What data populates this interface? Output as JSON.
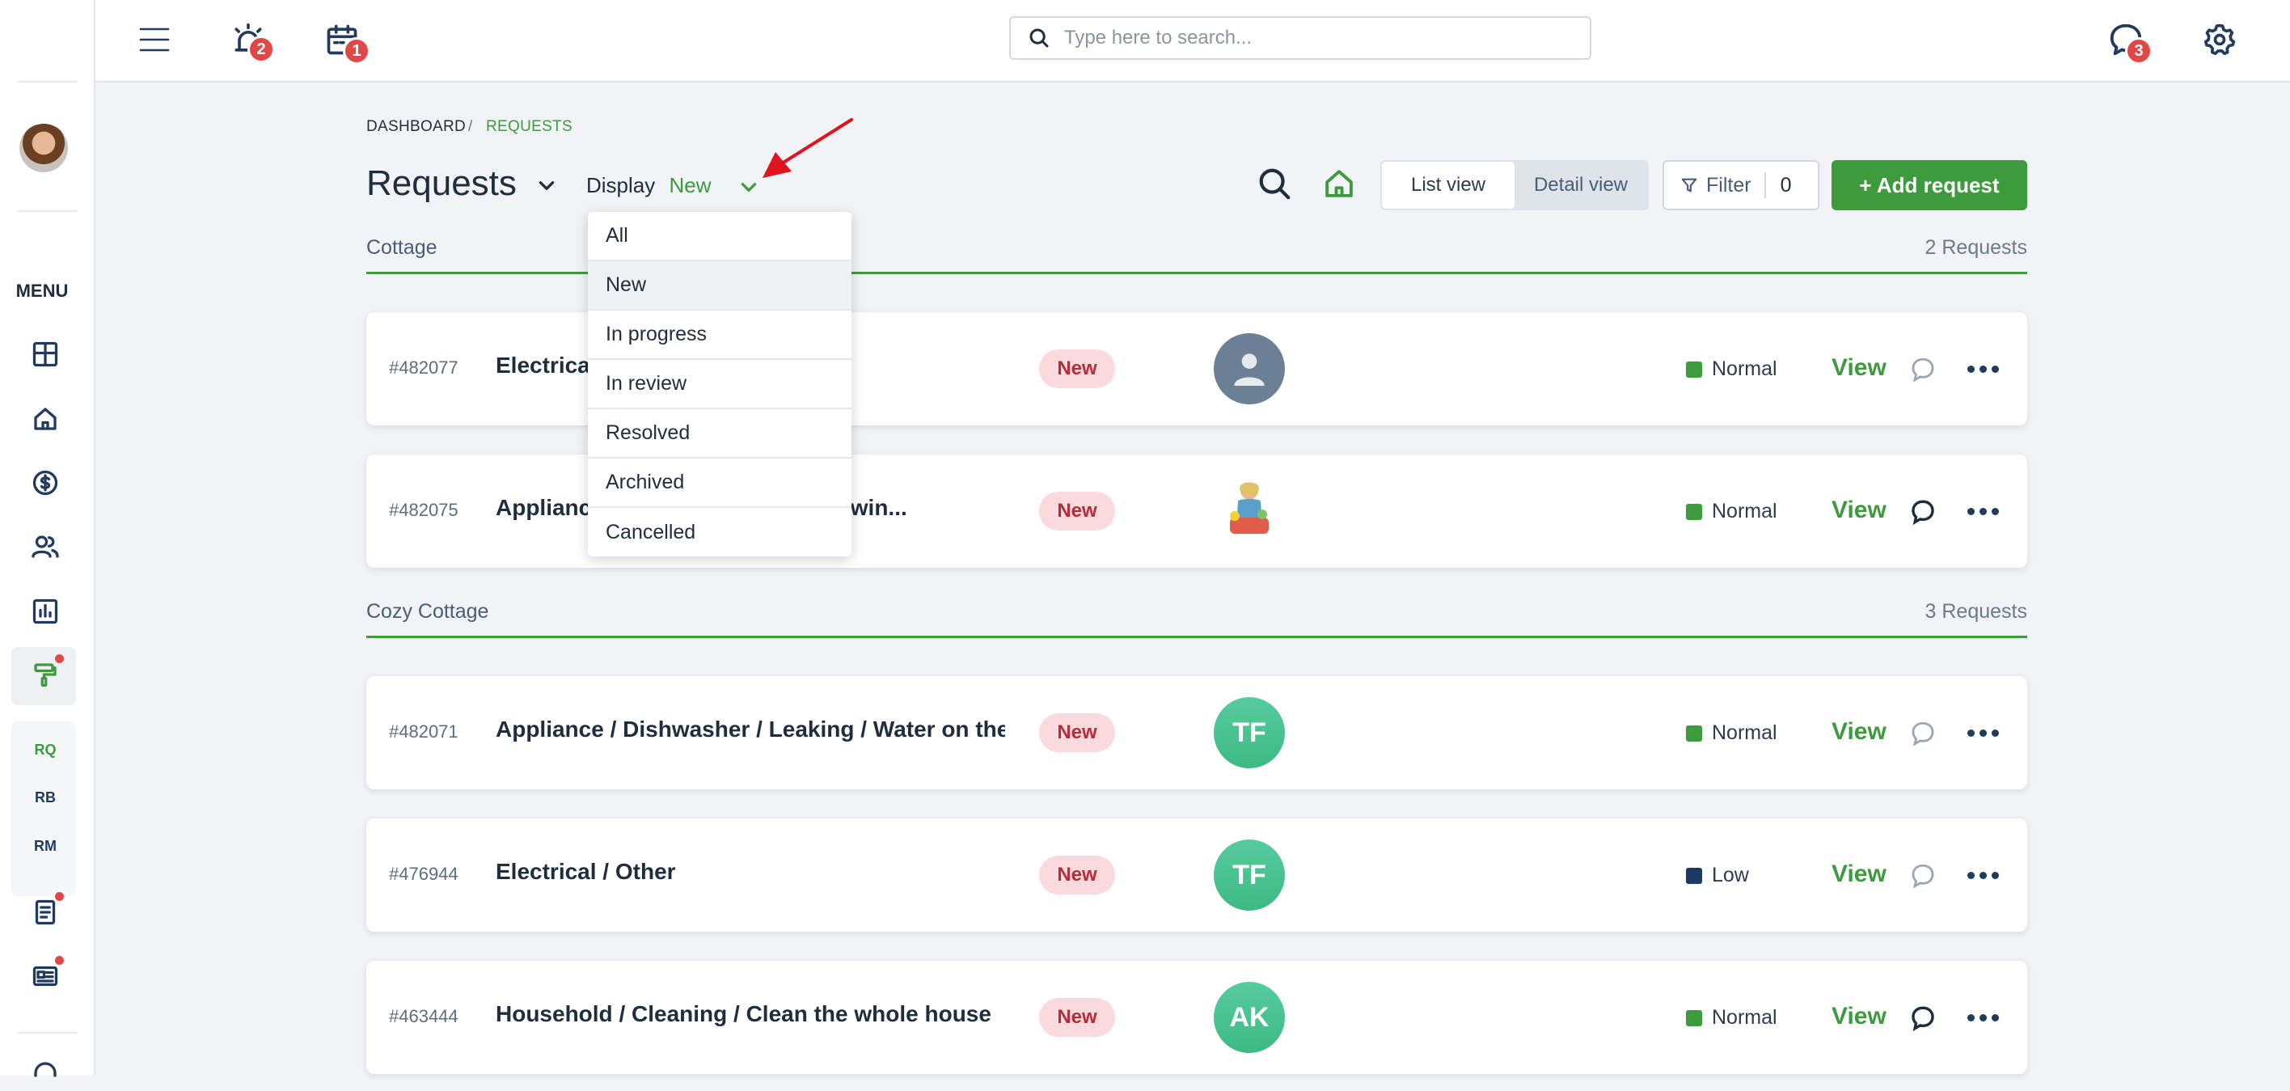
{
  "sidebar": {
    "menu_label": "MENU",
    "abbr": [
      "RQ",
      "RB",
      "RM"
    ],
    "icons": [
      "dashboard-icon",
      "home-icon",
      "dollar-icon",
      "users-icon",
      "chart-icon",
      "paint-roller-icon",
      "document-icon",
      "news-icon",
      "support-icon"
    ]
  },
  "topbar": {
    "alarm_badge": "2",
    "calendar_badge": "1",
    "messages_badge": "3",
    "search_placeholder": "Type here to search..."
  },
  "breadcrumb": {
    "home": "DASHBOARD",
    "separator": "/",
    "current": "REQUESTS"
  },
  "header": {
    "title": "Requests",
    "display_label": "Display",
    "display_value": "New",
    "list_view": "List view",
    "detail_view": "Detail view",
    "filter_label": "Filter",
    "filter_count": "0",
    "add_button": "+ Add request"
  },
  "display_dropdown": {
    "options": [
      "All",
      "New",
      "In progress",
      "In review",
      "Resolved",
      "Archived",
      "Cancelled"
    ],
    "selected": "New"
  },
  "groups": [
    {
      "name": "Cottage",
      "count": "2 Requests",
      "requests": [
        {
          "id": "#482077",
          "title": "Electrical / Lighting / Flickering",
          "status": "New",
          "avatar": "",
          "avatar_type": "placeholder",
          "priority": "Normal",
          "priority_color": "#3d9b3d",
          "view": "View",
          "chat": "chat-outline-icon"
        },
        {
          "id": "#482075",
          "title": "Appliance / Heater / No heat / Blowin...",
          "status": "New",
          "avatar": "",
          "avatar_type": "photo",
          "priority": "Normal",
          "priority_color": "#3d9b3d",
          "view": "View",
          "chat": "chat-filled-icon"
        }
      ]
    },
    {
      "name": "Cozy Cottage",
      "count": "3 Requests",
      "requests": [
        {
          "id": "#482071",
          "title": "Appliance / Dishwasher / Leaking / Water on the...",
          "status": "New",
          "avatar": "TF",
          "avatar_type": "initials",
          "priority": "Normal",
          "priority_color": "#3d9b3d",
          "view": "View",
          "chat": "chat-outline-icon"
        },
        {
          "id": "#476944",
          "title": "Electrical / Other",
          "status": "New",
          "avatar": "TF",
          "avatar_type": "initials",
          "priority": "Low",
          "priority_color": "#1b3a63",
          "view": "View",
          "chat": "chat-outline-icon"
        },
        {
          "id": "#463444",
          "title": "Household / Cleaning / Clean the whole house",
          "status": "New",
          "avatar": "AK",
          "avatar_type": "initials",
          "priority": "Normal",
          "priority_color": "#3d9b3d",
          "view": "View",
          "chat": "chat-filled-icon"
        }
      ]
    }
  ],
  "colors": {
    "accent": "#3d9b3d",
    "badge_red": "#e04848",
    "status_bg": "#fadadd",
    "status_text": "#b32d3a",
    "arrow": "#e0141c"
  }
}
